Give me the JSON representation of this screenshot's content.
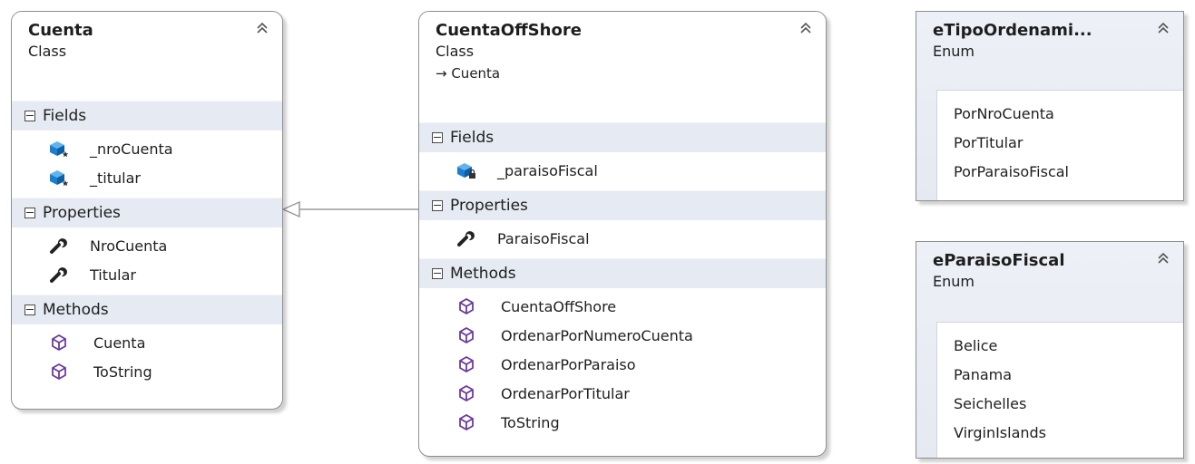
{
  "shapes": {
    "cuenta": {
      "name": "Cuenta",
      "kind": "Class",
      "sections": {
        "fields": {
          "title": "Fields",
          "items": [
            "_nroCuenta",
            "_titular"
          ]
        },
        "properties": {
          "title": "Properties",
          "items": [
            "NroCuenta",
            "Titular"
          ]
        },
        "methods": {
          "title": "Methods",
          "items": [
            "Cuenta",
            "ToString"
          ]
        }
      }
    },
    "cuentaOffShore": {
      "name": "CuentaOffShore",
      "kind": "Class",
      "base": "→ Cuenta",
      "sections": {
        "fields": {
          "title": "Fields",
          "items": [
            "_paraisoFiscal"
          ]
        },
        "properties": {
          "title": "Properties",
          "items": [
            "ParaisoFiscal"
          ]
        },
        "methods": {
          "title": "Methods",
          "items": [
            "CuentaOffShore",
            "OrdenarPorNumeroCuenta",
            "OrdenarPorParaiso",
            "OrdenarPorTitular",
            "ToString"
          ]
        }
      }
    },
    "eTipoOrdenamiento": {
      "name": "eTipoOrdenami...",
      "kind": "Enum",
      "values": [
        "PorNroCuenta",
        "PorTitular",
        "PorParaisoFiscal"
      ]
    },
    "eParaisoFiscal": {
      "name": "eParaisoFiscal",
      "kind": "Enum",
      "values": [
        "Belice",
        "Panama",
        "Seichelles",
        "VirginIslands"
      ]
    }
  },
  "icons": {
    "field_public": "field-icon",
    "field_private": "private-field-icon",
    "property": "wrench-icon",
    "method": "method-cube-icon",
    "collapse": "double-chevron-up-icon",
    "section_toggle": "minus-box-icon"
  },
  "colors": {
    "section_band": "#e6eaf3",
    "border": "#8e8e8e",
    "field_icon": "#1a7fd0",
    "method_icon": "#6b3aa0",
    "inheritance_line": "#9a9a9a"
  }
}
